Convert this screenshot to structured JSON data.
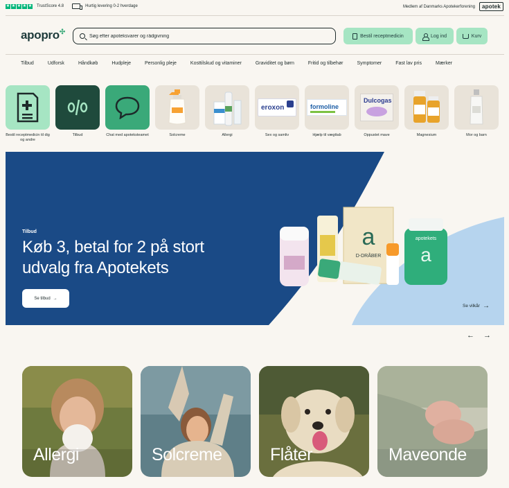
{
  "topbar": {
    "trustscore": "TrustScore 4.8",
    "delivery": "Hurtig levering 0-2 hverdage",
    "member_text": "Medlem af Danmarks Apotekerforening",
    "apotek_logo": "apotek"
  },
  "header": {
    "logo_text": "apopro",
    "search_placeholder": "Søg efter apoteksvarer og rådgivning",
    "prescription_button": "Bestil receptmedicin",
    "login_button": "Log ind",
    "cart_button": "Kurv"
  },
  "nav": {
    "items": [
      "Tilbud",
      "Udforsk",
      "Håndkøb",
      "Hudpleje",
      "Personlig pleje",
      "Kosttilskud og vitaminer",
      "Graviditet og børn",
      "Fritid og tilbehør",
      "Symptomer",
      "Fast lav pris",
      "Mærker"
    ]
  },
  "categories": [
    {
      "label": "Bestil receptmedicin til dig og andre",
      "icon": "prescription-document-icon",
      "bg": "#a6e5c3"
    },
    {
      "label": "Tilbud",
      "icon": "percent-icon",
      "bg": "#1f4a3c"
    },
    {
      "label": "Chat med apoteksteamet",
      "icon": "chat-bubble-icon",
      "bg": "#3aa979"
    },
    {
      "label": "Solcreme"
    },
    {
      "label": "Allergi"
    },
    {
      "label": "Sex og samliv",
      "product_text": "eroxon"
    },
    {
      "label": "Hjælp til vægttab",
      "product_text": "formoline"
    },
    {
      "label": "Oppustet mave",
      "product_text": "Dulcogas"
    },
    {
      "label": "Magnesium"
    },
    {
      "label": "Mor og barn"
    }
  ],
  "hero": {
    "tag": "Tilbud",
    "title": "Køb 3, betal for 2 på stort udvalg fra Apotekets",
    "button": "Se tilbud",
    "terms": "Se vilkår",
    "product_text_1": "a",
    "product_text_2": "D-DRÅBER",
    "product_text_3": "apotekets"
  },
  "carousel": {
    "prev": "←",
    "next": "→"
  },
  "promos": [
    {
      "label": "Allergi"
    },
    {
      "label": "Solcreme"
    },
    {
      "label": "Flåter"
    },
    {
      "label": "Maveonde"
    }
  ],
  "colors": {
    "accent_green": "#a6e5c3",
    "hero_blue": "#1a4a86",
    "hero_light_blue": "#b6d4ee",
    "trustpilot": "#00b67a"
  }
}
